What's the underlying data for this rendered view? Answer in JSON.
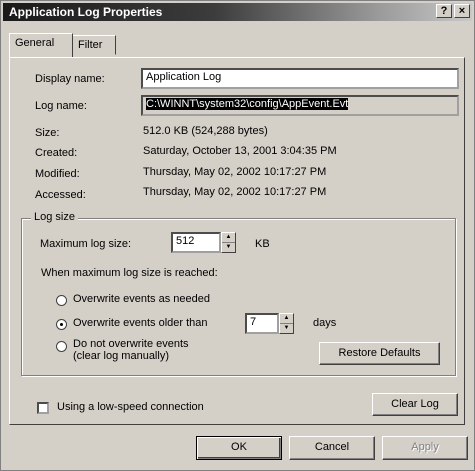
{
  "window": {
    "title": "Application Log Properties",
    "help_label": "?",
    "close_label": "×"
  },
  "tabs": [
    {
      "label": "General"
    },
    {
      "label": "Filter"
    }
  ],
  "general": {
    "display_name_label": "Display name:",
    "display_name_value": "Application Log",
    "log_name_label": "Log name:",
    "log_name_value": "C:\\WINNT\\system32\\config\\AppEvent.Evt",
    "size_label": "Size:",
    "size_value": "512.0 KB (524,288 bytes)",
    "created_label": "Created:",
    "created_value": "Saturday, October 13, 2001 3:04:35 PM",
    "modified_label": "Modified:",
    "modified_value": "Thursday, May 02, 2002 10:17:27 PM",
    "accessed_label": "Accessed:",
    "accessed_value": "Thursday, May 02, 2002 10:17:27 PM"
  },
  "log_size": {
    "group_label": "Log size",
    "max_label": "Maximum log size:",
    "max_value": "512",
    "unit": "KB",
    "when_label": "When maximum log size is reached:",
    "options": [
      {
        "label": "Overwrite events as needed",
        "selected": false
      },
      {
        "label": "Overwrite events older than",
        "selected": true
      },
      {
        "label": "Do not overwrite events",
        "selected": false
      }
    ],
    "option3_sub": "(clear log manually)",
    "days_value": "7",
    "days_label": "days",
    "restore_label": "Restore Defaults"
  },
  "low_speed_label": "Using a low-speed connection",
  "low_speed_checked": false,
  "clear_log_label": "Clear Log",
  "footer": {
    "ok": "OK",
    "cancel": "Cancel",
    "apply": "Apply"
  }
}
